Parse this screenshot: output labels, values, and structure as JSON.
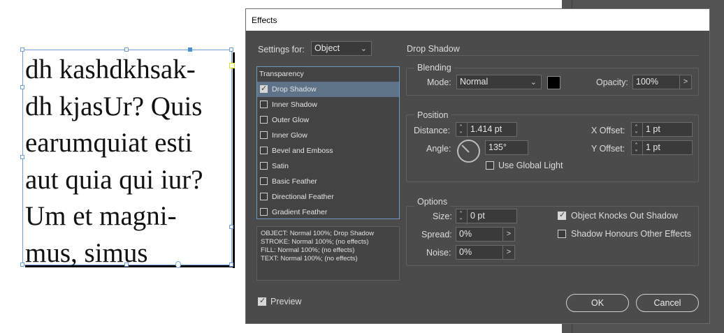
{
  "canvas": {
    "frame_text_lines": [
      " dh kashdkhsak-",
      "dh kjasUr? Quis",
      "earumquiat esti",
      "aut quia qui iur?",
      "Um et magni-",
      "mus, simus"
    ]
  },
  "dialog": {
    "title": "Effects",
    "settings_for_label": "Settings for:",
    "settings_for_value": "Object",
    "effects_header": "Transparency",
    "effects": [
      {
        "label": "Drop Shadow",
        "checked": true,
        "selected": true
      },
      {
        "label": "Inner Shadow",
        "checked": false
      },
      {
        "label": "Outer Glow",
        "checked": false
      },
      {
        "label": "Inner Glow",
        "checked": false
      },
      {
        "label": "Bevel and Emboss",
        "checked": false
      },
      {
        "label": "Satin",
        "checked": false
      },
      {
        "label": "Basic Feather",
        "checked": false
      },
      {
        "label": "Directional Feather",
        "checked": false
      },
      {
        "label": "Gradient Feather",
        "checked": false
      }
    ],
    "summary_lines": [
      "OBJECT: Normal 100%; Drop Shadow",
      "STROKE: Normal 100%; (no effects)",
      "FILL: Normal 100%; (no effects)",
      "TEXT: Normal 100%; (no effects)"
    ],
    "preview_label": "Preview",
    "preview_checked": true,
    "section_title": "Drop Shadow",
    "blending": {
      "title": "Blending",
      "mode_label": "Mode:",
      "mode_value": "Normal",
      "shadow_color": "#000000",
      "opacity_label": "Opacity:",
      "opacity_value": "100%"
    },
    "position": {
      "title": "Position",
      "distance_label": "Distance:",
      "distance_value": "1.414 pt",
      "angle_label": "Angle:",
      "angle_value": "135°",
      "global_light_label": "Use Global Light",
      "global_light_checked": false,
      "x_offset_label": "X Offset:",
      "x_offset_value": "1 pt",
      "y_offset_label": "Y Offset:",
      "y_offset_value": "1 pt"
    },
    "options": {
      "title": "Options",
      "size_label": "Size:",
      "size_value": "0 pt",
      "spread_label": "Spread:",
      "spread_value": "0%",
      "noise_label": "Noise:",
      "noise_value": "0%",
      "knocks_out_label": "Object Knocks Out Shadow",
      "knocks_out_checked": true,
      "honours_label": "Shadow Honours Other Effects",
      "honours_checked": false
    },
    "ok_label": "OK",
    "cancel_label": "Cancel"
  },
  "colors": {
    "dialog_bg": "#4b4b4b",
    "selection_accent": "#5e7388",
    "frame_border": "#6fa0d8"
  }
}
